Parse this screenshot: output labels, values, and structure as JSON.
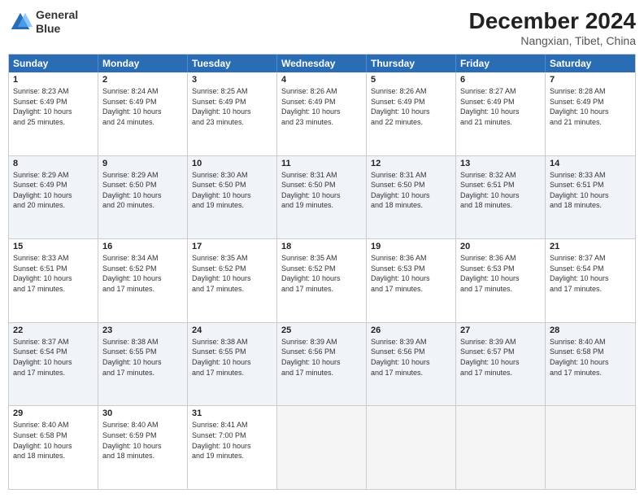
{
  "logo": {
    "line1": "General",
    "line2": "Blue"
  },
  "title": "December 2024",
  "subtitle": "Nangxian, Tibet, China",
  "header_days": [
    "Sunday",
    "Monday",
    "Tuesday",
    "Wednesday",
    "Thursday",
    "Friday",
    "Saturday"
  ],
  "rows": [
    [
      {
        "day": "1",
        "text": "Sunrise: 8:23 AM\nSunset: 6:49 PM\nDaylight: 10 hours\nand 25 minutes."
      },
      {
        "day": "2",
        "text": "Sunrise: 8:24 AM\nSunset: 6:49 PM\nDaylight: 10 hours\nand 24 minutes."
      },
      {
        "day": "3",
        "text": "Sunrise: 8:25 AM\nSunset: 6:49 PM\nDaylight: 10 hours\nand 23 minutes."
      },
      {
        "day": "4",
        "text": "Sunrise: 8:26 AM\nSunset: 6:49 PM\nDaylight: 10 hours\nand 23 minutes."
      },
      {
        "day": "5",
        "text": "Sunrise: 8:26 AM\nSunset: 6:49 PM\nDaylight: 10 hours\nand 22 minutes."
      },
      {
        "day": "6",
        "text": "Sunrise: 8:27 AM\nSunset: 6:49 PM\nDaylight: 10 hours\nand 21 minutes."
      },
      {
        "day": "7",
        "text": "Sunrise: 8:28 AM\nSunset: 6:49 PM\nDaylight: 10 hours\nand 21 minutes."
      }
    ],
    [
      {
        "day": "8",
        "text": "Sunrise: 8:29 AM\nSunset: 6:49 PM\nDaylight: 10 hours\nand 20 minutes."
      },
      {
        "day": "9",
        "text": "Sunrise: 8:29 AM\nSunset: 6:50 PM\nDaylight: 10 hours\nand 20 minutes."
      },
      {
        "day": "10",
        "text": "Sunrise: 8:30 AM\nSunset: 6:50 PM\nDaylight: 10 hours\nand 19 minutes."
      },
      {
        "day": "11",
        "text": "Sunrise: 8:31 AM\nSunset: 6:50 PM\nDaylight: 10 hours\nand 19 minutes."
      },
      {
        "day": "12",
        "text": "Sunrise: 8:31 AM\nSunset: 6:50 PM\nDaylight: 10 hours\nand 18 minutes."
      },
      {
        "day": "13",
        "text": "Sunrise: 8:32 AM\nSunset: 6:51 PM\nDaylight: 10 hours\nand 18 minutes."
      },
      {
        "day": "14",
        "text": "Sunrise: 8:33 AM\nSunset: 6:51 PM\nDaylight: 10 hours\nand 18 minutes."
      }
    ],
    [
      {
        "day": "15",
        "text": "Sunrise: 8:33 AM\nSunset: 6:51 PM\nDaylight: 10 hours\nand 17 minutes."
      },
      {
        "day": "16",
        "text": "Sunrise: 8:34 AM\nSunset: 6:52 PM\nDaylight: 10 hours\nand 17 minutes."
      },
      {
        "day": "17",
        "text": "Sunrise: 8:35 AM\nSunset: 6:52 PM\nDaylight: 10 hours\nand 17 minutes."
      },
      {
        "day": "18",
        "text": "Sunrise: 8:35 AM\nSunset: 6:52 PM\nDaylight: 10 hours\nand 17 minutes."
      },
      {
        "day": "19",
        "text": "Sunrise: 8:36 AM\nSunset: 6:53 PM\nDaylight: 10 hours\nand 17 minutes."
      },
      {
        "day": "20",
        "text": "Sunrise: 8:36 AM\nSunset: 6:53 PM\nDaylight: 10 hours\nand 17 minutes."
      },
      {
        "day": "21",
        "text": "Sunrise: 8:37 AM\nSunset: 6:54 PM\nDaylight: 10 hours\nand 17 minutes."
      }
    ],
    [
      {
        "day": "22",
        "text": "Sunrise: 8:37 AM\nSunset: 6:54 PM\nDaylight: 10 hours\nand 17 minutes."
      },
      {
        "day": "23",
        "text": "Sunrise: 8:38 AM\nSunset: 6:55 PM\nDaylight: 10 hours\nand 17 minutes."
      },
      {
        "day": "24",
        "text": "Sunrise: 8:38 AM\nSunset: 6:55 PM\nDaylight: 10 hours\nand 17 minutes."
      },
      {
        "day": "25",
        "text": "Sunrise: 8:39 AM\nSunset: 6:56 PM\nDaylight: 10 hours\nand 17 minutes."
      },
      {
        "day": "26",
        "text": "Sunrise: 8:39 AM\nSunset: 6:56 PM\nDaylight: 10 hours\nand 17 minutes."
      },
      {
        "day": "27",
        "text": "Sunrise: 8:39 AM\nSunset: 6:57 PM\nDaylight: 10 hours\nand 17 minutes."
      },
      {
        "day": "28",
        "text": "Sunrise: 8:40 AM\nSunset: 6:58 PM\nDaylight: 10 hours\nand 17 minutes."
      }
    ],
    [
      {
        "day": "29",
        "text": "Sunrise: 8:40 AM\nSunset: 6:58 PM\nDaylight: 10 hours\nand 18 minutes."
      },
      {
        "day": "30",
        "text": "Sunrise: 8:40 AM\nSunset: 6:59 PM\nDaylight: 10 hours\nand 18 minutes."
      },
      {
        "day": "31",
        "text": "Sunrise: 8:41 AM\nSunset: 7:00 PM\nDaylight: 10 hours\nand 19 minutes."
      },
      {
        "day": "",
        "text": ""
      },
      {
        "day": "",
        "text": ""
      },
      {
        "day": "",
        "text": ""
      },
      {
        "day": "",
        "text": ""
      }
    ]
  ]
}
